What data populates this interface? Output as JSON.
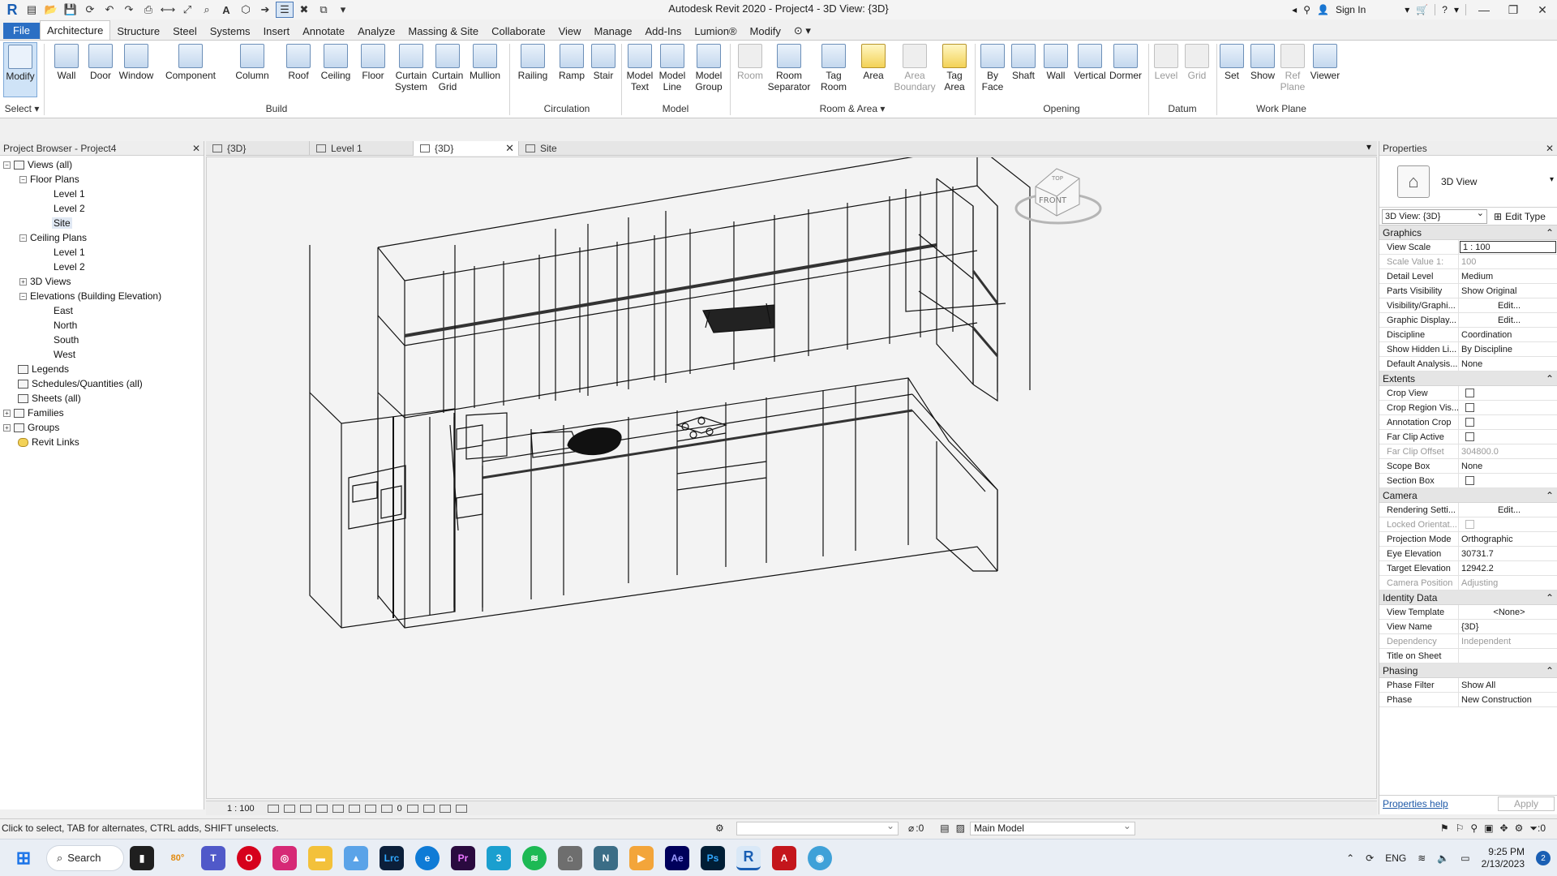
{
  "title_bar": {
    "title": "Autodesk Revit 2020 - Project4 - 3D View: {3D}",
    "sign_in": "Sign In"
  },
  "menu": {
    "tabs": [
      "File",
      "Architecture",
      "Structure",
      "Steel",
      "Systems",
      "Insert",
      "Annotate",
      "Analyze",
      "Massing & Site",
      "Collaborate",
      "View",
      "Manage",
      "Add-Ins",
      "Lumion®",
      "Modify"
    ],
    "active": "Architecture"
  },
  "ribbon": {
    "select": {
      "modify": "Modify",
      "select_label": "Select ▾"
    },
    "build": {
      "label": "Build",
      "wall": "Wall",
      "door": "Door",
      "window": "Window",
      "component": "Component",
      "column": "Column",
      "roof": "Roof",
      "ceiling": "Ceiling",
      "floor": "Floor",
      "curtain_system": "Curtain System",
      "curtain_grid": "Curtain Grid",
      "mullion": "Mullion"
    },
    "circulation": {
      "label": "Circulation",
      "railing": "Railing",
      "ramp": "Ramp",
      "stair": "Stair"
    },
    "model": {
      "label": "Model",
      "model_text": "Model Text",
      "model_line": "Model Line",
      "model_group": "Model Group"
    },
    "room_area": {
      "label": "Room & Area ▾",
      "room": "Room",
      "room_separator": "Room Separator",
      "tag_room": "Tag Room",
      "area": "Area",
      "area_boundary": "Area Boundary",
      "tag_area": "Tag Area"
    },
    "opening": {
      "label": "Opening",
      "by_face": "By Face",
      "shaft": "Shaft",
      "wall": "Wall",
      "vertical": "Vertical",
      "dormer": "Dormer"
    },
    "datum": {
      "label": "Datum",
      "level": "Level",
      "grid": "Grid"
    },
    "work_plane": {
      "label": "Work Plane",
      "set": "Set",
      "show": "Show",
      "ref_plane": "Ref Plane",
      "viewer": "Viewer"
    }
  },
  "project_browser": {
    "title": "Project Browser - Project4",
    "items": [
      {
        "label": "Views (all)",
        "level": 0,
        "toggle": "−"
      },
      {
        "label": "Floor Plans",
        "level": 1,
        "toggle": "−"
      },
      {
        "label": "Level 1",
        "level": 2
      },
      {
        "label": "Level 2",
        "level": 2
      },
      {
        "label": "Site",
        "level": 2,
        "selected": true
      },
      {
        "label": "Ceiling Plans",
        "level": 1,
        "toggle": "−"
      },
      {
        "label": "Level 1",
        "level": 2
      },
      {
        "label": "Level 2",
        "level": 2
      },
      {
        "label": "3D Views",
        "level": 1,
        "toggle": "+"
      },
      {
        "label": "Elevations (Building Elevation)",
        "level": 1,
        "toggle": "−"
      },
      {
        "label": "East",
        "level": 2
      },
      {
        "label": "North",
        "level": 2
      },
      {
        "label": "South",
        "level": 2
      },
      {
        "label": "West",
        "level": 2
      },
      {
        "label": "Legends",
        "level": 0
      },
      {
        "label": "Schedules/Quantities (all)",
        "level": 0
      },
      {
        "label": "Sheets (all)",
        "level": 0
      },
      {
        "label": "Families",
        "level": 0,
        "toggle": "+"
      },
      {
        "label": "Groups",
        "level": 0,
        "toggle": "+"
      },
      {
        "label": "Revit Links",
        "level": 0
      }
    ]
  },
  "view_tabs": [
    {
      "label": "{3D}"
    },
    {
      "label": "Level 1"
    },
    {
      "label": "{3D}",
      "active": true
    },
    {
      "label": "Site"
    }
  ],
  "view_bar": {
    "scale": "1 : 100",
    "counter": "0"
  },
  "view_cube": {
    "top": "TOP",
    "front": "FRONT"
  },
  "properties": {
    "title": "Properties",
    "type_name": "3D View",
    "selector": "3D View: {3D}",
    "edit_type": "Edit Type",
    "sections": [
      {
        "name": "Graphics",
        "rows": [
          {
            "k": "View Scale",
            "v": "1 : 100",
            "boxed": true
          },
          {
            "k": "Scale Value    1:",
            "v": "100",
            "dim": true
          },
          {
            "k": "Detail Level",
            "v": "Medium"
          },
          {
            "k": "Parts Visibility",
            "v": "Show Original"
          },
          {
            "k": "Visibility/Graphi...",
            "v": "Edit...",
            "btn": true
          },
          {
            "k": "Graphic Display...",
            "v": "Edit...",
            "btn": true
          },
          {
            "k": "Discipline",
            "v": "Coordination"
          },
          {
            "k": "Show Hidden Li...",
            "v": "By Discipline"
          },
          {
            "k": "Default Analysis...",
            "v": "None"
          }
        ]
      },
      {
        "name": "Extents",
        "rows": [
          {
            "k": "Crop View",
            "check": true
          },
          {
            "k": "Crop Region Vis...",
            "check": true
          },
          {
            "k": "Annotation Crop",
            "check": true
          },
          {
            "k": "Far Clip Active",
            "check": true
          },
          {
            "k": "Far Clip Offset",
            "v": "304800.0",
            "dim": true
          },
          {
            "k": "Scope Box",
            "v": "None"
          },
          {
            "k": "Section Box",
            "check": true
          }
        ]
      },
      {
        "name": "Camera",
        "rows": [
          {
            "k": "Rendering Setti...",
            "v": "Edit...",
            "btn": true
          },
          {
            "k": "Locked Orientat...",
            "check": true,
            "dim": true
          },
          {
            "k": "Projection Mode",
            "v": "Orthographic"
          },
          {
            "k": "Eye Elevation",
            "v": "30731.7"
          },
          {
            "k": "Target Elevation",
            "v": "12942.2"
          },
          {
            "k": "Camera Position",
            "v": "Adjusting",
            "dim": true
          }
        ]
      },
      {
        "name": "Identity Data",
        "rows": [
          {
            "k": "View Template",
            "v": "<None>",
            "btn": true
          },
          {
            "k": "View Name",
            "v": "{3D}"
          },
          {
            "k": "Dependency",
            "v": "Independent",
            "dim": true
          },
          {
            "k": "Title on Sheet",
            "v": ""
          }
        ]
      },
      {
        "name": "Phasing",
        "rows": [
          {
            "k": "Phase Filter",
            "v": "Show All"
          },
          {
            "k": "Phase",
            "v": "New Construction"
          }
        ]
      }
    ],
    "help": "Properties help",
    "apply": "Apply"
  },
  "status_bar": {
    "message": "Click to select, TAB for alternates, CTRL adds, SHIFT unselects.",
    "counter": ":0",
    "model": "Main Model",
    "filter_count": ":0"
  },
  "taskbar": {
    "search": "Search",
    "weather": "80°",
    "language": "ENG",
    "time": "9:25 PM",
    "date": "2/13/2023",
    "notifications": "2",
    "apps": [
      "Task View",
      "Weather",
      "Teams",
      "Opera",
      "Instagram",
      "File Explorer",
      "Photos",
      "Lightroom Classic",
      "Edge",
      "Premiere",
      "Calculator",
      "Spotify",
      "Network",
      "Navisworks",
      "Media",
      "After Effects",
      "Photoshop",
      "Revit",
      "AutoCAD",
      "Lumion"
    ]
  }
}
